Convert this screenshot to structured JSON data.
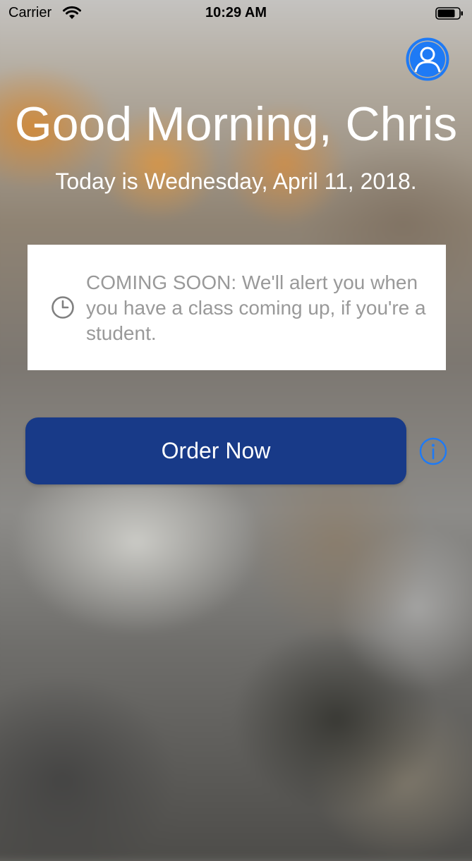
{
  "status_bar": {
    "carrier": "Carrier",
    "time": "10:29 AM"
  },
  "header": {
    "greeting": "Good Morning, Chris",
    "date_line": "Today is Wednesday, April 11, 2018."
  },
  "notice": {
    "text": "COMING SOON: We'll alert you when you have a class coming up, if you're a student.",
    "icon": "clock-icon"
  },
  "actions": {
    "order_label": "Order Now",
    "info_icon": "info-icon",
    "profile_icon": "profile-icon"
  },
  "colors": {
    "accent_blue": "#1e7af5",
    "button_navy": "#183a88",
    "notice_text": "#999999"
  }
}
